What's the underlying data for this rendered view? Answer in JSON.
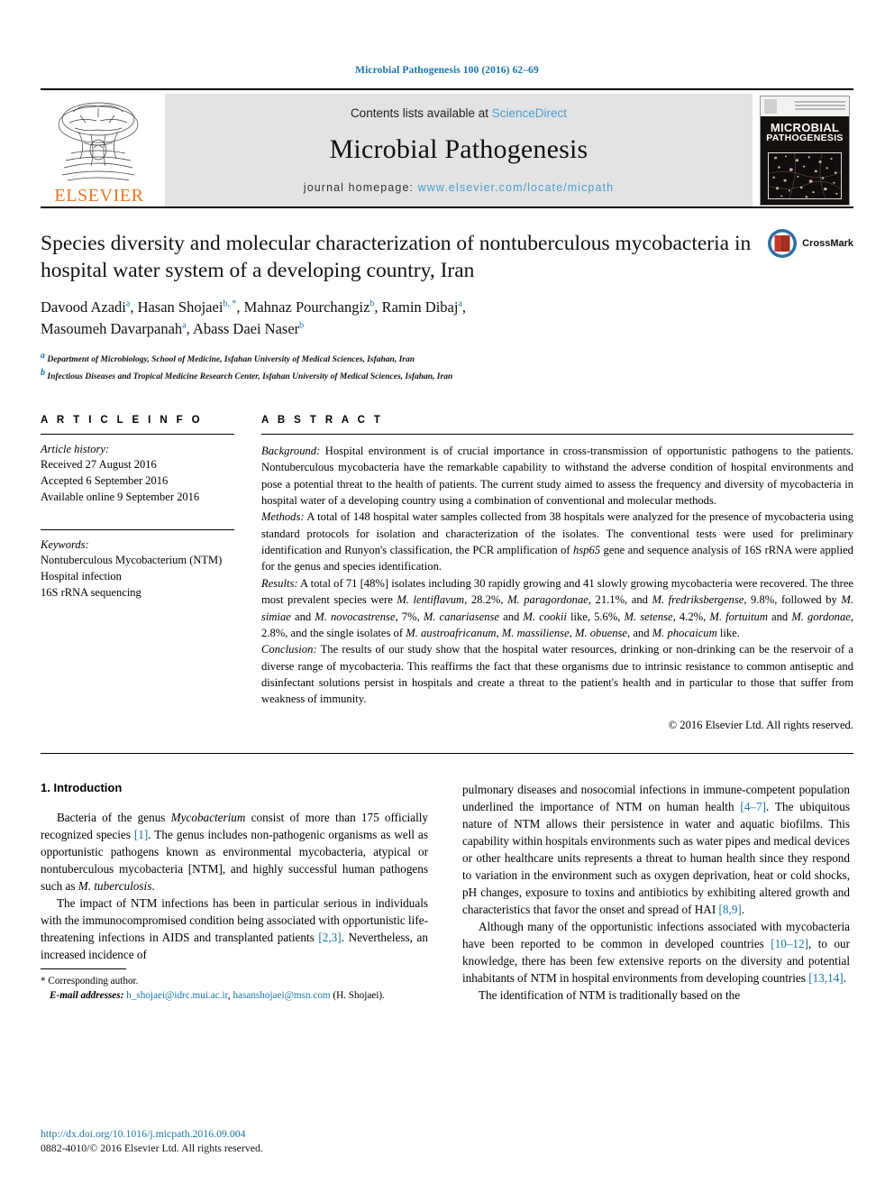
{
  "running_head": "Microbial Pathogenesis 100 (2016) 62–69",
  "banner": {
    "publisher": "ELSEVIER",
    "contents_prefix": "Contents lists available at ",
    "contents_link": "ScienceDirect",
    "journal_name": "Microbial Pathogenesis",
    "homepage_prefix": "journal homepage: ",
    "homepage_url": "www.elsevier.com/locate/micpath",
    "cover_title_line1": "MICROBIAL",
    "cover_title_line2": "PATHOGENESIS"
  },
  "article": {
    "title": "Species diversity and molecular characterization of nontuberculous mycobacteria in hospital water system of a developing country, Iran",
    "authors_line1_parts": [
      {
        "name": "Davood Azadi",
        "sup": "a"
      },
      {
        "name": "Hasan Shojaei",
        "sup": "b, *"
      },
      {
        "name": "Mahnaz Pourchangiz",
        "sup": "b"
      },
      {
        "name": "Ramin Dibaj",
        "sup": "a"
      }
    ],
    "authors_line2_parts": [
      {
        "name": "Masoumeh Davarpanah",
        "sup": "a"
      },
      {
        "name": "Abass Daei Naser",
        "sup": "b"
      }
    ],
    "affiliations": [
      {
        "sup": "a",
        "text": "Department of Microbiology, School of Medicine, Isfahan University of Medical Sciences, Isfahan, Iran"
      },
      {
        "sup": "b",
        "text": "Infectious Diseases and Tropical Medicine Research Center, Isfahan University of Medical Sciences, Isfahan, Iran"
      }
    ],
    "crossmark_label": "CrossMark"
  },
  "article_info": {
    "heading": "A R T I C L E   I N F O",
    "history_label": "Article history:",
    "history": [
      "Received 27 August 2016",
      "Accepted 6 September 2016",
      "Available online 9 September 2016"
    ],
    "keywords_label": "Keywords:",
    "keywords": [
      "Nontuberculous Mycobacterium (NTM)",
      "Hospital infection",
      "16S rRNA sequencing"
    ]
  },
  "abstract": {
    "heading": "A B S T R A C T",
    "background_label": "Background:",
    "background_text": " Hospital environment is of crucial importance in cross-transmission of opportunistic pathogens to the patients. Nontuberculous mycobacteria have the remarkable capability to withstand the adverse condition of hospital environments and pose a potential threat to the health of patients. The current study aimed to assess the frequency and diversity of mycobacteria in hospital water of a developing country using a combination of conventional and molecular methods.",
    "methods_label": "Methods:",
    "methods_text": " A total of 148 hospital water samples collected from 38 hospitals were analyzed for the presence of mycobacteria using standard protocols for isolation and characterization of the isolates. The conventional tests were used for preliminary identification and Runyon's classification, the PCR amplification of hsp65 gene and sequence analysis of 16S rRNA were applied for the genus and species identification.",
    "results_label": "Results:",
    "results_text": " A total of 71 [48%] isolates including 30 rapidly growing and 41 slowly growing mycobacteria were recovered. The three most prevalent species were M. lentiflavum, 28.2%, M. paragordonae, 21.1%, and M. fredriksbergense, 9.8%, followed by M. simiae and M. novocastrense, 7%, M. canariasense and M. cookii like, 5.6%, M. setense, 4.2%, M. fortuitum and M. gordonae, 2.8%, and the single isolates of M. austroafricanum, M. massiliense, M. obuense, and M. phocaicum like.",
    "conclusion_label": "Conclusion:",
    "conclusion_text": " The results of our study show that the hospital water resources, drinking or non-drinking can be the reservoir of a diverse range of mycobacteria. This reaffirms the fact that these organisms due to intrinsic resistance to common antiseptic and disinfectant solutions persist in hospitals and create a threat to the patient's health and in particular to those that suffer from weakness of immunity.",
    "copyright": "© 2016 Elsevier Ltd. All rights reserved."
  },
  "introduction": {
    "heading": "1. Introduction",
    "left_paragraph_1": "Bacteria of the genus Mycobacterium consist of more than 175 officially recognized species [1]. The genus includes non-pathogenic organisms as well as opportunistic pathogens known as environmental mycobacteria, atypical or nontuberculous mycobacteria [NTM], and highly successful human pathogens such as M. tuberculosis.",
    "left_paragraph_2": "The impact of NTM infections has been in particular serious in individuals with the immunocompromised condition being associated with opportunistic life-threatening infections in AIDS and transplanted patients [2,3]. Nevertheless, an increased incidence of",
    "right_paragraph_1": "pulmonary diseases and nosocomial infections in immune-competent population underlined the importance of NTM on human health [4–7]. The ubiquitous nature of NTM allows their persistence in water and aquatic biofilms. This capability within hospitals environments such as water pipes and medical devices or other healthcare units represents a threat to human health since they respond to variation in the environment such as oxygen deprivation, heat or cold shocks, pH changes, exposure to toxins and antibiotics by exhibiting altered growth and characteristics that favor the onset and spread of HAI [8,9].",
    "right_paragraph_2": "Although many of the opportunistic infections associated with mycobacteria have been reported to be common in developed countries [10–12], to our knowledge, there has been few extensive reports on the diversity and potential inhabitants of NTM in hospital environments from developing countries [13,14].",
    "right_paragraph_3": "The identification of NTM is traditionally based on the"
  },
  "footnote": {
    "corresponding_marker": "*",
    "corresponding_text": "Corresponding author.",
    "email_label": "E-mail addresses:",
    "email_1": "h_shojaei@idrc.mui.ac.ir",
    "email_separator": ", ",
    "email_2": "hasanshojaei@msn.com",
    "email_suffix": " (H. Shojaei)."
  },
  "page_footer": {
    "doi": "http://dx.doi.org/10.1016/j.micpath.2016.09.004",
    "issn_copyright": "0882-4010/© 2016 Elsevier Ltd. All rights reserved."
  },
  "colors": {
    "link_blue": "#1a75a8",
    "sd_blue": "#4a9fd0",
    "elsevier_orange": "#e87722",
    "banner_gray": "#e3e3e3"
  }
}
